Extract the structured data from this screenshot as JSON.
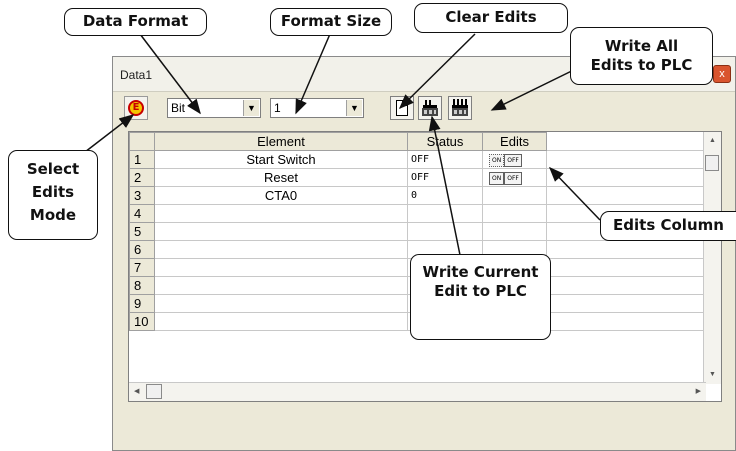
{
  "window": {
    "title": "Data1",
    "close_label": "x"
  },
  "toolbar": {
    "mode_button_glyph": "E",
    "data_format_value": "Bit",
    "format_size_value": "1"
  },
  "table": {
    "headers": [
      "",
      "Element",
      "Status",
      "Edits"
    ],
    "rows": [
      {
        "num": "1",
        "element": "Start Switch",
        "status": "OFF",
        "edits": [
          "ON",
          "OFF"
        ]
      },
      {
        "num": "2",
        "element": "Reset",
        "status": "OFF",
        "edits": [
          "ON",
          "OFF"
        ]
      },
      {
        "num": "3",
        "element": "CTA0",
        "status": "0",
        "edits": []
      },
      {
        "num": "4",
        "element": "",
        "status": "",
        "edits": []
      },
      {
        "num": "5",
        "element": "",
        "status": "",
        "edits": []
      },
      {
        "num": "6",
        "element": "",
        "status": "",
        "edits": []
      },
      {
        "num": "7",
        "element": "",
        "status": "",
        "edits": []
      },
      {
        "num": "8",
        "element": "",
        "status": "",
        "edits": []
      },
      {
        "num": "9",
        "element": "",
        "status": "",
        "edits": []
      },
      {
        "num": "10",
        "element": "",
        "status": "",
        "edits": []
      }
    ]
  },
  "callouts": {
    "data_format": "Data Format",
    "format_size": "Format Size",
    "clear_edits": "Clear Edits",
    "write_all": [
      "Write All",
      "Edits to PLC"
    ],
    "select_mode": [
      "Select",
      "Edits",
      "Mode"
    ],
    "edits_column": "Edits Column",
    "write_current": [
      "Write Current",
      "Edit to PLC"
    ]
  },
  "colors": {
    "accent_red": "#c80000",
    "mode_yellow": "#f5c400",
    "close_red": "#d9542e"
  }
}
